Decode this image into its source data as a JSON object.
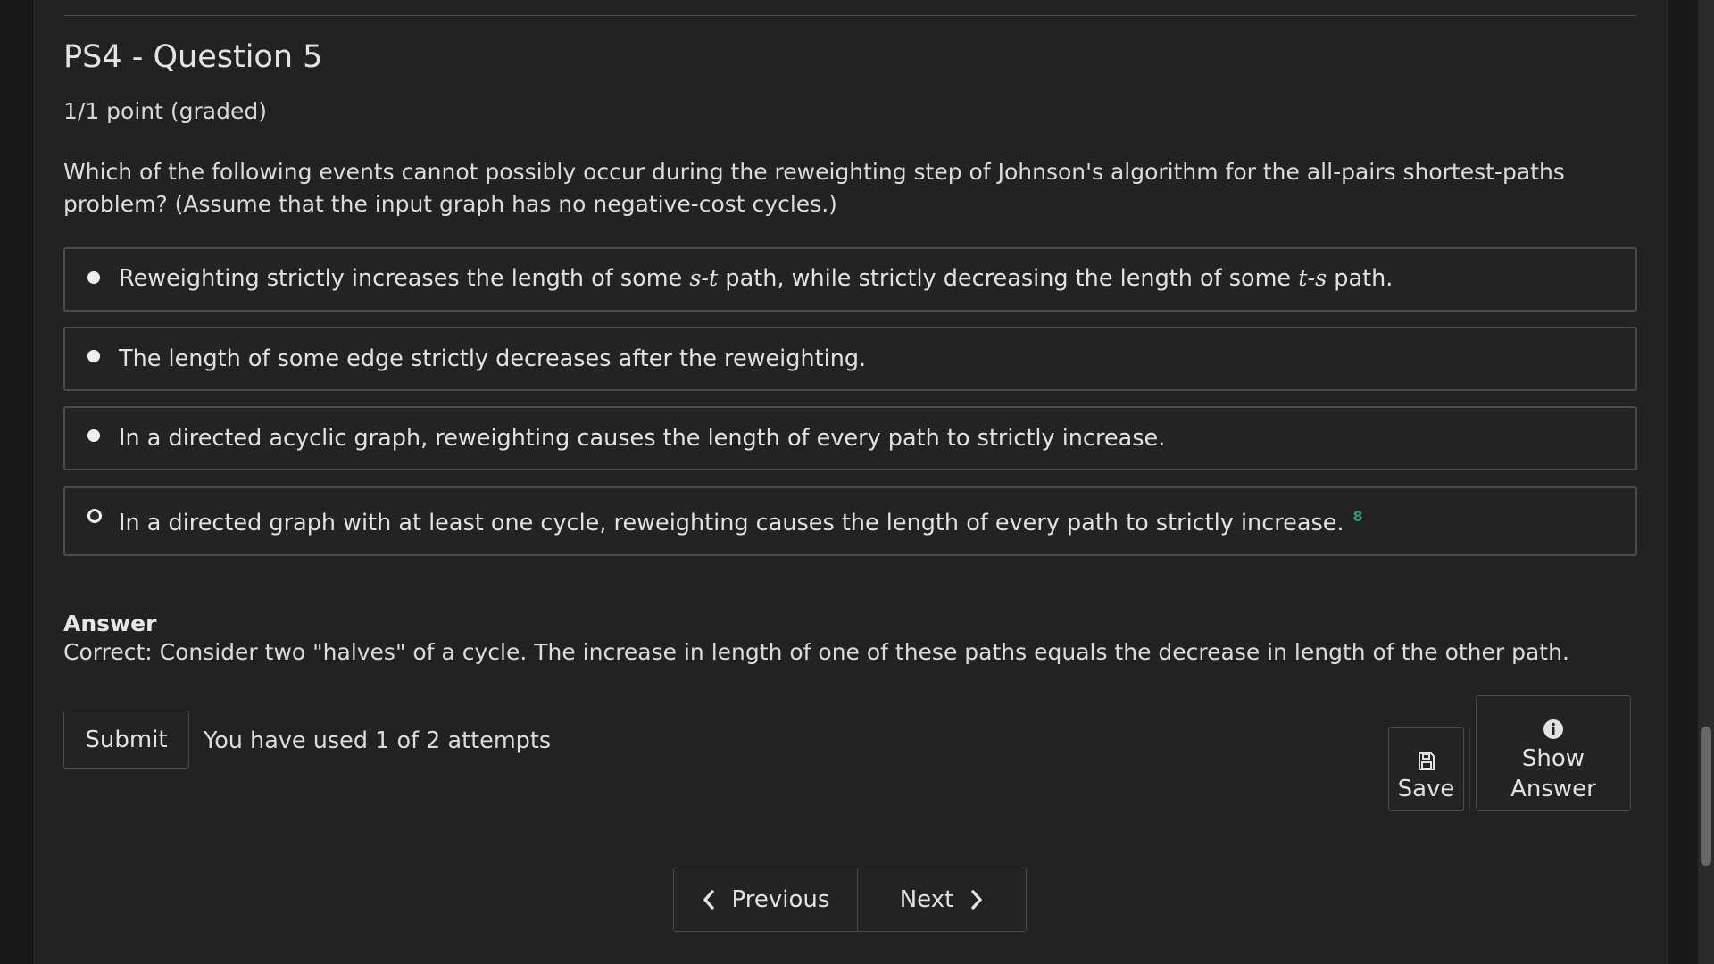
{
  "problem": {
    "title": "PS4 - Question 5",
    "points": "1/1 point (graded)",
    "question": "Which of the following events cannot possibly occur during the reweighting step of Johnson's algorithm for the all-pairs shortest-paths problem? (Assume that the input graph has no negative-cost cycles.)"
  },
  "choices": [
    {
      "prefix": "Reweighting strictly increases the length of some ",
      "math1": "s-t",
      "middle": " path, while strictly decreasing the length of some ",
      "math2": "t-s",
      "suffix": " path.",
      "selected": false
    },
    {
      "label": "The length of some edge strictly decreases after the reweighting.",
      "selected": false
    },
    {
      "label": "In a directed acyclic graph, reweighting causes the length of every path to strictly increase.",
      "selected": false
    },
    {
      "label": "In a directed graph with at least one cycle, reweighting causes the length of every path to strictly increase.",
      "selected": true,
      "mark": "8"
    }
  ],
  "answer": {
    "heading": "Answer",
    "text": "Correct:  Consider two \"halves\" of a cycle. The increase in length of one of these paths equals the decrease in length of the other path."
  },
  "actions": {
    "submit_label": "Submit",
    "attempts_text": "You have used 1 of 2 attempts",
    "save_label": "Save",
    "show_answer_line1": "Show",
    "show_answer_line2": "Answer"
  },
  "navigation": {
    "previous_label": "Previous",
    "next_label": "Next"
  },
  "icons": {
    "save": "save-icon",
    "show_answer": "info-icon",
    "previous": "chevron-left-icon",
    "next": "chevron-right-icon"
  },
  "colors": {
    "background": "#222222",
    "correct_mark": "#2b9c6e"
  }
}
